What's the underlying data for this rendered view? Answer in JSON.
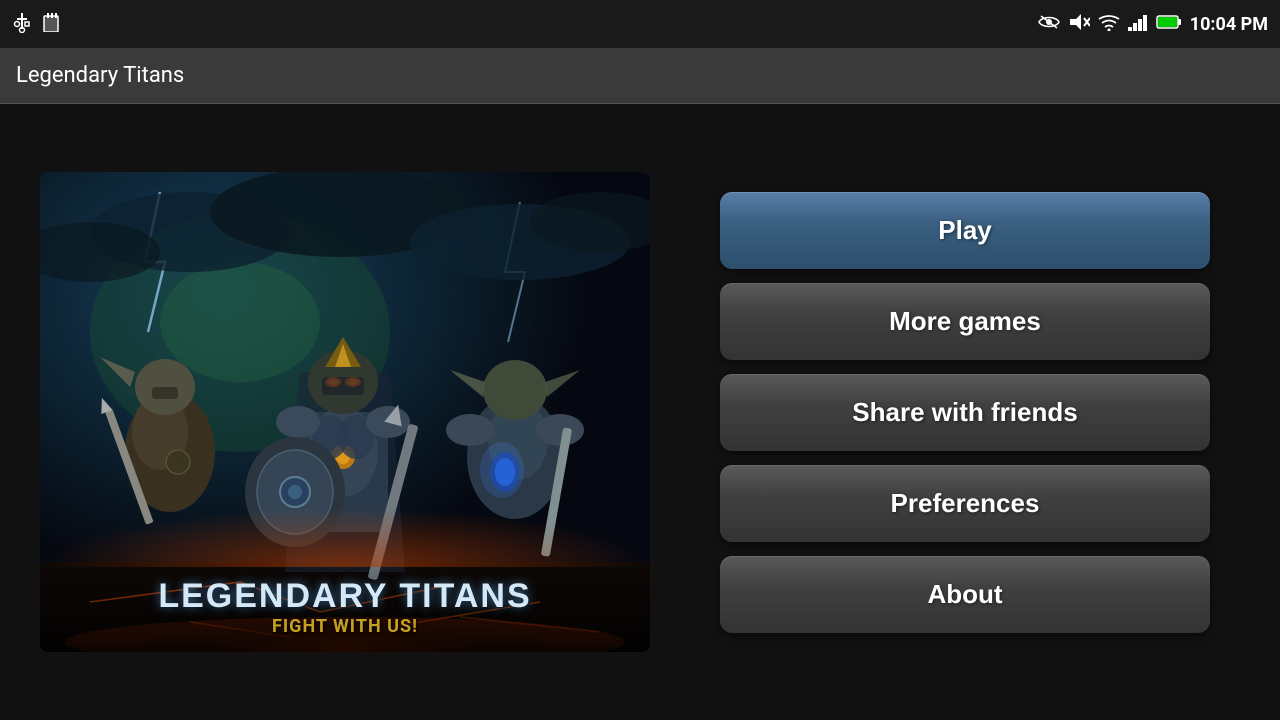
{
  "statusBar": {
    "time": "10:04 PM",
    "icons": {
      "usb": "⚡",
      "sd": "▣",
      "eye": "👁",
      "mute": "🔇",
      "wifi": "WiFi",
      "signal": "▲▲▲",
      "battery": "🔋"
    }
  },
  "actionBar": {
    "title": "Legendary Titans"
  },
  "gameImage": {
    "titleMain": "LEGENDARY TITANS",
    "titleSub": "FIGHT WITH US!"
  },
  "buttons": [
    {
      "id": "play",
      "label": "Play",
      "style": "play"
    },
    {
      "id": "more-games",
      "label": "More games",
      "style": "normal"
    },
    {
      "id": "share",
      "label": "Share with friends",
      "style": "normal"
    },
    {
      "id": "preferences",
      "label": "Preferences",
      "style": "normal"
    },
    {
      "id": "about",
      "label": "About",
      "style": "normal"
    }
  ]
}
